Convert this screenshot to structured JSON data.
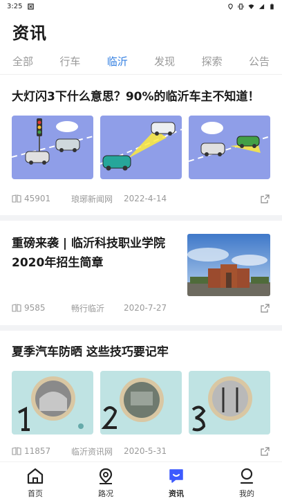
{
  "status": {
    "time": "3:25"
  },
  "page_title": "资讯",
  "tabs": [
    {
      "label": "全部"
    },
    {
      "label": "行车"
    },
    {
      "label": "临沂"
    },
    {
      "label": "发现"
    },
    {
      "label": "探索"
    },
    {
      "label": "公告"
    }
  ],
  "active_tab": "临沂",
  "articles": [
    {
      "title": "大灯闪3下什么意思？90%的临沂车主不知道！",
      "reads": "45901",
      "source": "琅琊新闻网",
      "date": "2022-4-14"
    },
    {
      "title": "重磅来袭 | 临沂科技职业学院2020年招生简章",
      "reads": "9585",
      "source": "畅行临沂",
      "date": "2020-7-27"
    },
    {
      "title": "夏季汽车防晒 这些技巧要记牢",
      "reads": "11857",
      "source": "临沂资讯网",
      "date": "2020-5-31"
    }
  ],
  "nav": [
    {
      "label": "首页",
      "icon": "home-icon"
    },
    {
      "label": "路况",
      "icon": "map-pin-icon"
    },
    {
      "label": "资讯",
      "icon": "chat-icon"
    },
    {
      "label": "我的",
      "icon": "user-icon"
    }
  ],
  "colors": {
    "accent": "#2f7de1",
    "nav_active": "#3d5afe"
  }
}
